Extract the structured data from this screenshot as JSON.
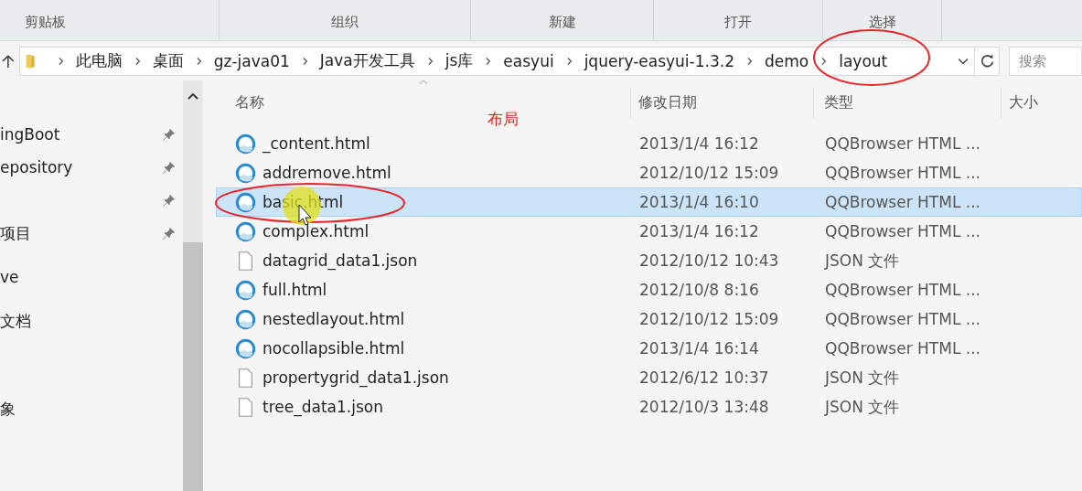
{
  "ribbon_groups": [
    {
      "label": "剪贴板"
    },
    {
      "label": "组织"
    },
    {
      "label": "新建"
    },
    {
      "label": "打开"
    },
    {
      "label": "选择"
    }
  ],
  "address_bar": {
    "breadcrumbs": [
      "此电脑",
      "桌面",
      "gz-java01",
      "Java开发工具",
      "js库",
      "easyui",
      "jquery-easyui-1.3.2",
      "demo",
      "layout"
    ]
  },
  "search": {
    "placeholder": "搜索"
  },
  "sidebar": {
    "items": [
      {
        "label": "ingBoot",
        "pinned": true
      },
      {
        "label": "epository",
        "pinned": true
      },
      {
        "pinned": true
      },
      {
        "label": "项目",
        "pinned": true
      },
      {
        "label": "ve",
        "pinned": false
      },
      {
        "label": "文档",
        "pinned": false
      },
      {
        "pinned": false
      },
      {
        "label": "象",
        "pinned": false
      }
    ]
  },
  "table": {
    "columns": [
      "名称",
      "修改日期",
      "类型",
      "大小"
    ],
    "rows": [
      {
        "name": "_content.html",
        "kind": "browser",
        "modified": "2013/1/4 16:12",
        "type": "QQBrowser HTML ...",
        "selected": false
      },
      {
        "name": "addremove.html",
        "kind": "browser",
        "modified": "2012/10/12 15:09",
        "type": "QQBrowser HTML ...",
        "selected": false
      },
      {
        "name": "basic.html",
        "kind": "browser",
        "modified": "2013/1/4 16:10",
        "type": "QQBrowser HTML ...",
        "selected": true
      },
      {
        "name": "complex.html",
        "kind": "browser",
        "modified": "2013/1/4 16:12",
        "type": "QQBrowser HTML ...",
        "selected": false
      },
      {
        "name": "datagrid_data1.json",
        "kind": "document",
        "modified": "2012/10/12 10:43",
        "type": "JSON 文件",
        "selected": false
      },
      {
        "name": "full.html",
        "kind": "browser",
        "modified": "2012/10/8 8:16",
        "type": "QQBrowser HTML ...",
        "selected": false
      },
      {
        "name": "nestedlayout.html",
        "kind": "browser",
        "modified": "2012/10/12 15:09",
        "type": "QQBrowser HTML ...",
        "selected": false
      },
      {
        "name": "nocollapsible.html",
        "kind": "browser",
        "modified": "2013/1/4 16:14",
        "type": "QQBrowser HTML ...",
        "selected": false
      },
      {
        "name": "propertygrid_data1.json",
        "kind": "document",
        "modified": "2012/6/12 10:37",
        "type": "JSON 文件",
        "selected": false
      },
      {
        "name": "tree_data1.json",
        "kind": "document",
        "modified": "2012/10/3 13:48",
        "type": "JSON 文件",
        "selected": false
      }
    ]
  },
  "annotation": {
    "text": "布局"
  }
}
